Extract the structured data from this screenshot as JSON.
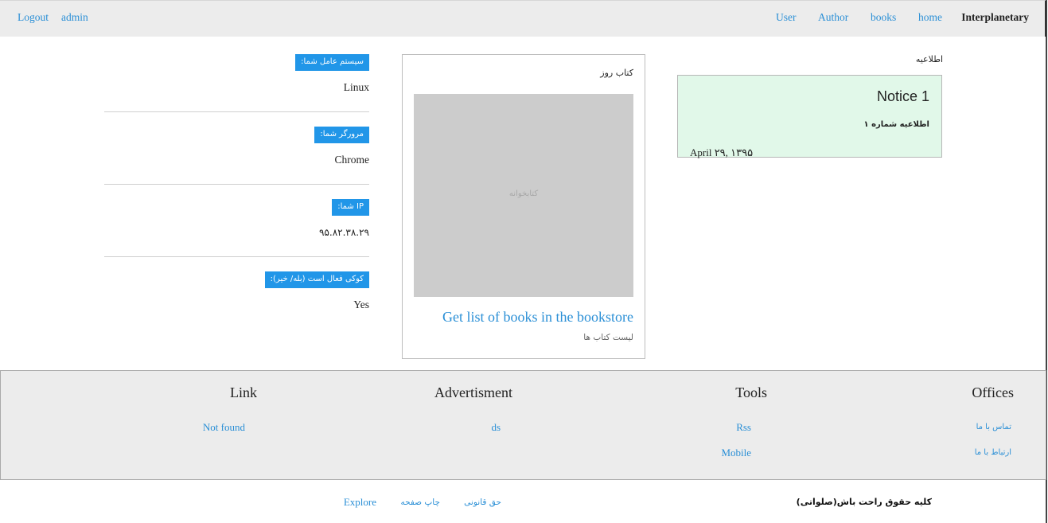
{
  "nav": {
    "brand": "Interplanetary",
    "home": "home",
    "books": "books",
    "author": "Author",
    "user": "User",
    "admin": "admin",
    "logout": "Logout"
  },
  "client_info": [
    {
      "label": "سیستم عامل شما:",
      "value": "Linux"
    },
    {
      "label": "مرورگر شما:",
      "value": "Chrome"
    },
    {
      "label": "IP شما:",
      "value": "۹۵.۸۲.۳۸.۲۹"
    },
    {
      "label": "کوکی فعال است (بله/ خیر):",
      "value": "Yes"
    }
  ],
  "book_of_day": {
    "heading": "کتاب روز",
    "image_placeholder": "کتابخوانه",
    "link": "Get list of books in the bookstore",
    "subtitle": "لیست کتاب ها"
  },
  "notices": {
    "heading": "اطلاعیه",
    "items": [
      {
        "title": "Notice 1",
        "text": "اطلاعیه شماره ۱",
        "date": "April ۲۹, ۱۳۹۵"
      }
    ]
  },
  "footer": {
    "offices": {
      "title": "Offices",
      "links": [
        "تماس با ما",
        "ارتباط با ما"
      ]
    },
    "tools": {
      "title": "Tools",
      "links": [
        "Rss",
        "Mobile"
      ]
    },
    "advertisment": {
      "title": "Advertisment",
      "links": [
        "ds"
      ]
    },
    "link": {
      "title": "Link",
      "links": [
        "Not found"
      ]
    }
  },
  "bottom": {
    "copyright": "کلیه حقوق راحت باش(صلواتی)",
    "legal": "حق قانونی",
    "print": "چاپ صفحه",
    "explore": "Explore"
  },
  "colors": {
    "accent": "#2a8fd6",
    "label_bg": "#2196e8",
    "notice_bg": "#e1f8e9",
    "bar_bg": "#ececec"
  }
}
